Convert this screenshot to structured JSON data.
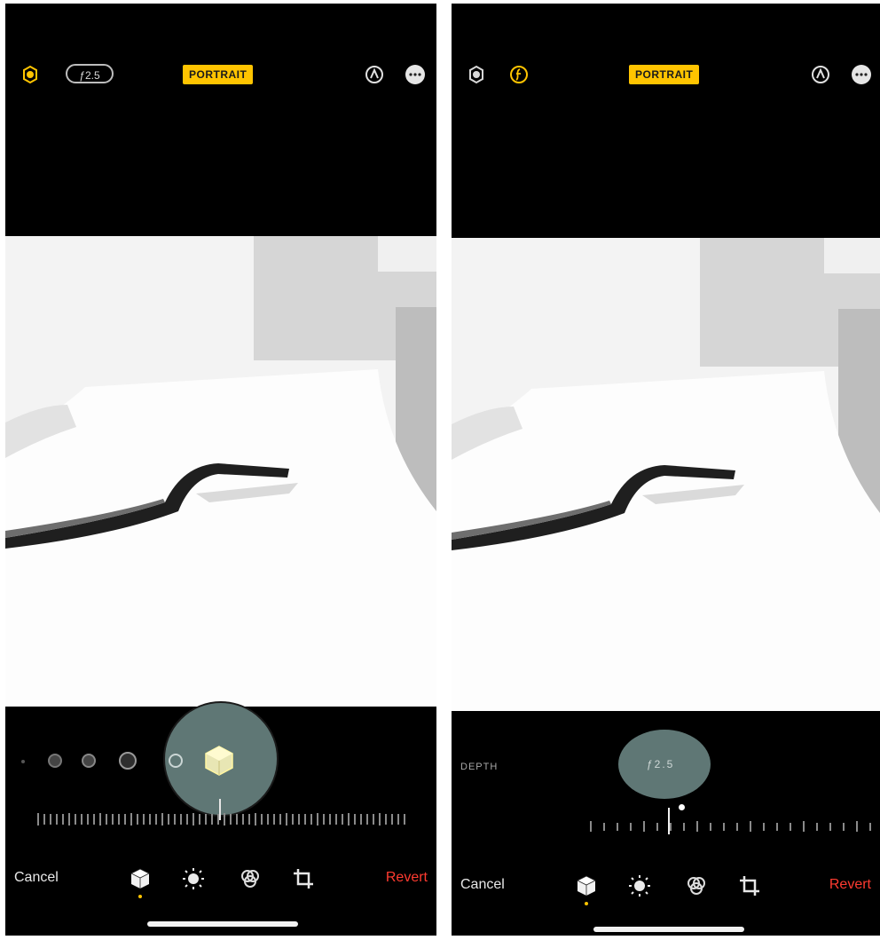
{
  "left": {
    "aperture_value": "ƒ2.5",
    "mode_badge": "PORTRAIT",
    "cancel_label": "Cancel",
    "revert_label": "Revert"
  },
  "right": {
    "mode_badge": "PORTRAIT",
    "depth_label": "DEPTH",
    "depth_value": "ƒ2.5",
    "cancel_label": "Cancel",
    "revert_label": "Revert"
  },
  "colors": {
    "accent_yellow": "#ffc400",
    "revert_red": "#ff3b30",
    "highlight_teal": "#5f7775"
  },
  "icons": {
    "top_left": "portrait-lighting-icon",
    "top_aperture": "aperture-icon",
    "top_auto": "auto-enhance-icon",
    "top_more": "more-icon",
    "tool_portrait": "cube-icon",
    "tool_adjust": "sun-dial-icon",
    "tool_filters": "filters-icon",
    "tool_crop": "crop-icon"
  }
}
